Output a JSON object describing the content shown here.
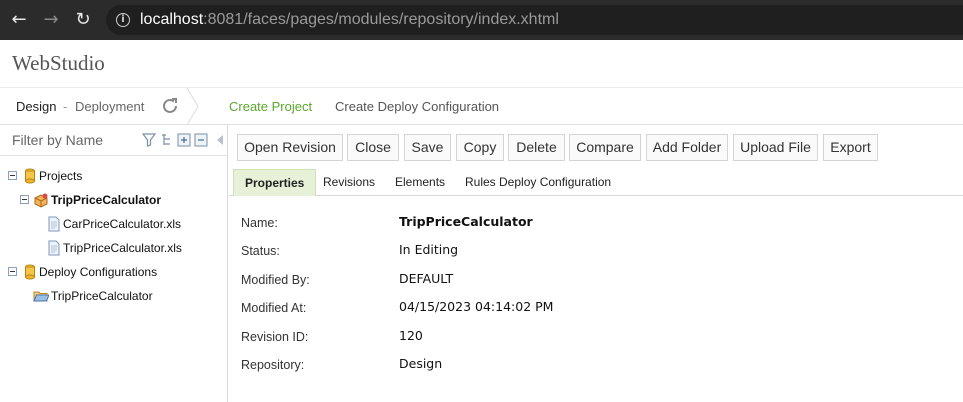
{
  "browser": {
    "url_host": "localhost",
    "url_path": ":8081/faces/pages/modules/repository/index.xhtml",
    "back_icon": "arrow-left-icon",
    "forward_icon": "arrow-right-icon",
    "reload_icon": "reload-icon",
    "info_icon": "info-icon"
  },
  "app": {
    "title": "WebStudio"
  },
  "breadcrumb": {
    "design": "Design",
    "separator": "-",
    "deployment": "Deployment"
  },
  "header_links": {
    "create_project": "Create Project",
    "create_deploy_config": "Create Deploy Configuration"
  },
  "sidebar": {
    "filter_placeholder": "Filter by Name",
    "tree": [
      {
        "label": "Projects",
        "level": 0,
        "icon": "repository-icon",
        "expanded": true
      },
      {
        "label": "TripPriceCalculator",
        "level": 1,
        "icon": "project-icon",
        "expanded": true,
        "bold": true
      },
      {
        "label": "CarPriceCalculator.xls",
        "level": 2,
        "icon": "file-icon"
      },
      {
        "label": "TripPriceCalculator.xls",
        "level": 2,
        "icon": "file-icon"
      },
      {
        "label": "Deploy Configurations",
        "level": 0,
        "icon": "repository-icon",
        "expanded": true
      },
      {
        "label": "TripPriceCalculator",
        "level": 1,
        "icon": "folder-open-icon"
      }
    ]
  },
  "toolbar": {
    "buttons": [
      "Open Revision",
      "Close",
      "Save",
      "Copy",
      "Delete",
      "Compare",
      "Add Folder",
      "Upload File",
      "Export"
    ]
  },
  "tabs": {
    "items": [
      "Properties",
      "Revisions",
      "Elements",
      "Rules Deploy Configuration"
    ],
    "active": "Properties"
  },
  "properties": [
    {
      "label": "Name:",
      "value": "TripPriceCalculator"
    },
    {
      "label": "Status:",
      "value": "In Editing"
    },
    {
      "label": "Modified By:",
      "value": "DEFAULT"
    },
    {
      "label": "Modified At:",
      "value": "04/15/2023 04:14:02 PM"
    },
    {
      "label": "Revision ID:",
      "value": "120"
    },
    {
      "label": "Repository:",
      "value": "Design"
    }
  ],
  "colors": {
    "accent_green": "#5aa82b",
    "active_tab_bg": "#e7f1d8",
    "browser_bar": "#2b2b2b"
  }
}
